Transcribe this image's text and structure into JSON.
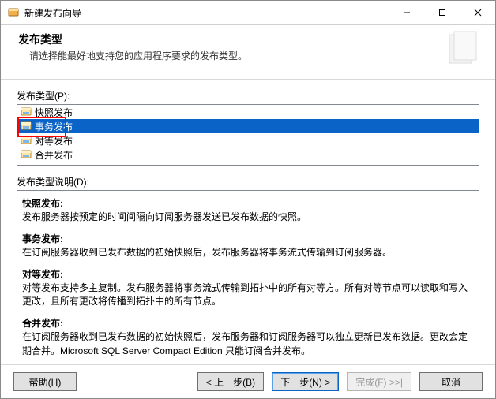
{
  "titlebar": {
    "title": "新建发布向导"
  },
  "banner": {
    "title": "发布类型",
    "subtitle": "请选择能最好地支持您的应用程序要求的发布类型。"
  },
  "labels": {
    "type_list": "发布类型(P):",
    "type_desc": "发布类型说明(D):"
  },
  "list": {
    "items": [
      {
        "label": "快照发布",
        "selected": false
      },
      {
        "label": "事务发布",
        "selected": true
      },
      {
        "label": "对等发布",
        "selected": false
      },
      {
        "label": "合并发布",
        "selected": false
      }
    ]
  },
  "desc": {
    "sections": [
      {
        "title": "快照发布:",
        "body": "发布服务器按预定的时间间隔向订阅服务器发送已发布数据的快照。"
      },
      {
        "title": "事务发布:",
        "body": "在订阅服务器收到已发布数据的初始快照后，发布服务器将事务流式传输到订阅服务器。"
      },
      {
        "title": "对等发布:",
        "body": "对等发布支持多主复制。发布服务器将事务流式传输到拓扑中的所有对等方。所有对等节点可以读取和写入更改，且所有更改将传播到拓扑中的所有节点。"
      },
      {
        "title": "合并发布:",
        "body": "在订阅服务器收到已发布数据的初始快照后，发布服务器和订阅服务器可以独立更新已发布数据。更改会定期合并。Microsoft SQL Server Compact Edition 只能订阅合并发布。"
      }
    ]
  },
  "buttons": {
    "help": "帮助(H)",
    "back": "< 上一步(B)",
    "next": "下一步(N) >",
    "finish": "完成(F) >>|",
    "cancel": "取消"
  }
}
